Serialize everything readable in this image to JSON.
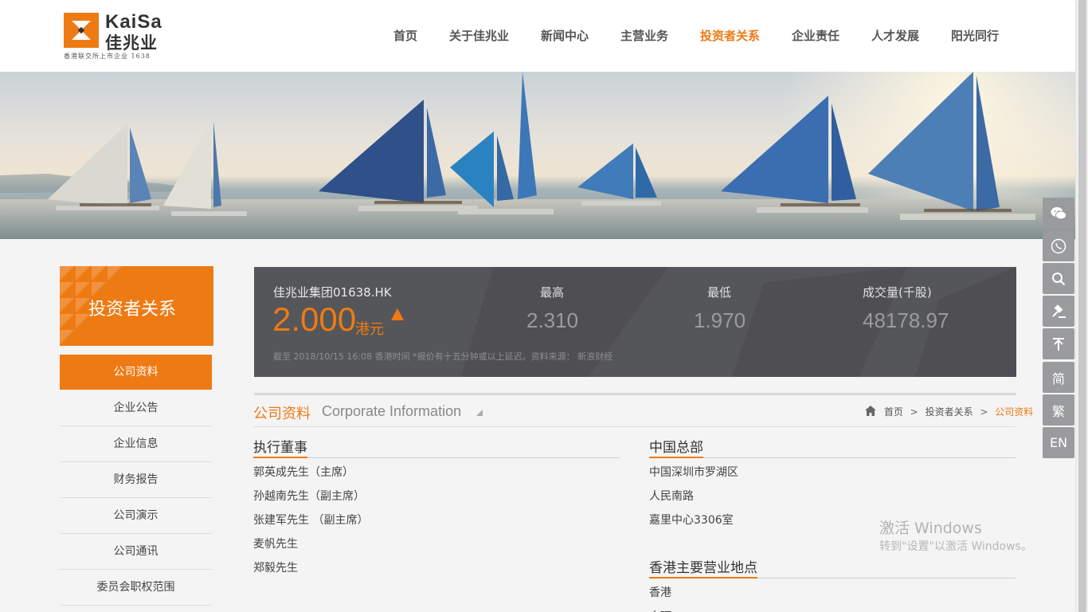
{
  "header": {
    "logo_en": "KaiSa",
    "logo_cn": "佳兆业",
    "logo_sub": "香港联交所上市企业 1638"
  },
  "nav": [
    {
      "label": "首页",
      "active": false
    },
    {
      "label": "关于佳兆业",
      "active": false
    },
    {
      "label": "新闻中心",
      "active": false
    },
    {
      "label": "主营业务",
      "active": false
    },
    {
      "label": "投资者关系",
      "active": true
    },
    {
      "label": "企业责任",
      "active": false
    },
    {
      "label": "人才发展",
      "active": false
    },
    {
      "label": "阳光同行",
      "active": false
    }
  ],
  "sidebar": {
    "title": "投资者关系",
    "items": [
      {
        "label": "公司资料",
        "active": true
      },
      {
        "label": "企业公告",
        "active": false
      },
      {
        "label": "企业信息",
        "active": false
      },
      {
        "label": "财务报告",
        "active": false
      },
      {
        "label": "公司演示",
        "active": false
      },
      {
        "label": "公司通讯",
        "active": false
      },
      {
        "label": "委员会职权范围",
        "active": false
      }
    ]
  },
  "stock": {
    "name": "佳兆业集团01638.HK",
    "price": "2.000",
    "unit": "港元",
    "high_label": "最高",
    "high_value": "2.310",
    "low_label": "最低",
    "low_value": "1.970",
    "volume_label": "成交量(千股)",
    "volume_value": "48178.97",
    "note": "截至 2018/10/15 16:08 香港时间 *报价有十五分钟或以上延迟。资料来源： 新浪财经"
  },
  "section": {
    "title_cn": "公司资料",
    "title_en": "Corporate Information"
  },
  "breadcrumb": {
    "home": "首页",
    "sep": ">",
    "parent": "投资者关系",
    "current": "公司资料"
  },
  "directors": {
    "heading": "执行董事",
    "lines": [
      "郭英成先生（主席）",
      "孙越南先生（副主席）",
      "张建军先生 （副主席）",
      "麦帆先生",
      "郑毅先生"
    ]
  },
  "hq": {
    "heading": "中国总部",
    "lines": [
      "中国深圳市罗湖区",
      "人民南路",
      "嘉里中心3306室"
    ]
  },
  "hk": {
    "heading": "香港主要营业地点",
    "lines": [
      "香港",
      "中环"
    ]
  },
  "tools": {
    "simplified": "简",
    "traditional": "繁",
    "english": "EN"
  },
  "watermark": {
    "line1": "激活 Windows",
    "line2": "转到\"设置\"以激活 Windows。"
  },
  "colors": {
    "accent": "#ee7a14",
    "stock_bg": "#55565a",
    "tool_bg": "#9a9b9d"
  }
}
